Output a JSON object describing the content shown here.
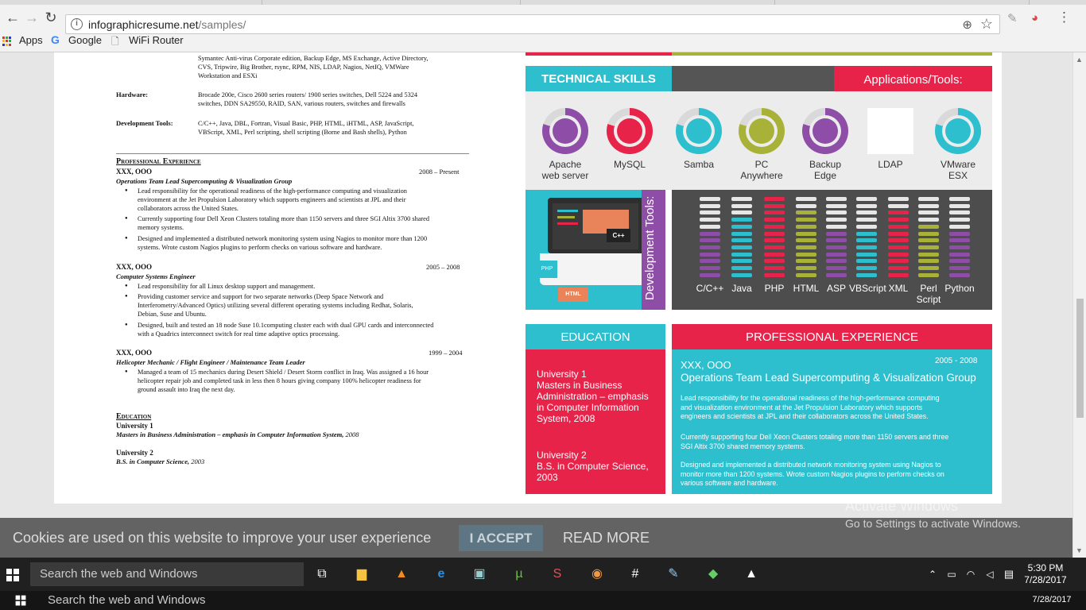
{
  "browser": {
    "url_domain": "infographicresume.net",
    "url_path": "/samples/",
    "bookmarks": [
      "Apps",
      "Google",
      "WiFi Router"
    ]
  },
  "resume": {
    "software_lines": [
      "Symantec Anti-virus Corporate edition, Backup Edge, MS Exchange, Active Directory,",
      "CVS, Tripwire, Big Brother, rsync, RPM, NIS, LDAP, Nagios, NetIQ, VMWare",
      "Workstation and ESXi"
    ],
    "hardware_label": "Hardware:",
    "hardware_lines": [
      "Brocade 200e, Cisco 2600 series routers/ 1900 series switches, Dell 5224 and 5324",
      "switches, DDN SA29550, RAID, SAN, various routers, switches and firewalls"
    ],
    "devtools_label": "Development Tools:",
    "devtools_lines": [
      "C/C++, Java, DBL, Fortran, Visual Basic, PHP, HTML, iHTML, ASP, JavaScript,",
      "VBScript, XML, Perl scripting, shell scripting (Borne and Bash shells), Python"
    ],
    "experience_heading": "Professional Experience",
    "jobs": [
      {
        "company": "XXX, OOO",
        "dates": "2008 – Present",
        "title": "Operations Team Lead Supercomputing & Visualization Group",
        "bullets": [
          [
            "Lead responsibility for the operational readiness of the high-performance computing and visualization",
            "environment at the Jet Propulsion Laboratory which supports engineers and scientists at JPL and their",
            "collaborators across the United States."
          ],
          [
            "Currently supporting four Dell Xeon Clusters totaling more than 1150 servers and three SGI Altix 3700 shared",
            "memory systems."
          ],
          [
            "Designed and implemented a distributed network monitoring system using Nagios to monitor more than 1200",
            "systems.  Wrote custom Nagios plugins to perform checks on various software and hardware."
          ]
        ]
      },
      {
        "company": "XXX, OOO",
        "dates": "2005 – 2008",
        "title": "Computer Systems Engineer",
        "bullets": [
          [
            "Lead responsibility for all Linux desktop support and management."
          ],
          [
            "Providing customer service and support for two separate networks (Deep Space Network and",
            "Interferometry/Advanced Optics) utilizing several different operating systems including Redhat, Solaris,",
            "Debian, Suse and Ubuntu."
          ],
          [
            "Designed, built and tested an 18 node Suse 10.1computing cluster each with dual GPU cards and interconnected",
            "with a Quadrics interconnect switch for real time adaptive optics processing."
          ]
        ]
      },
      {
        "company": "XXX, OOO",
        "dates": "1999 – 2004",
        "title": "Helicopter Mechanic / Flight Engineer / Maintenance Team Leader",
        "bullets": [
          [
            "Managed a team of 15 mechanics during Desert Shield / Desert Storm conflict in Iraq.  Was assigned a 16 hour",
            "helicopter repair job and completed task in less then 8 hours giving company 100% helicopter readiness for",
            "ground assault into Iraq the next day."
          ]
        ]
      }
    ],
    "education_heading": "Education",
    "schools": [
      {
        "name": "University 1",
        "degree": "Masters in Business Administration – emphasis in Computer Information System,",
        "year": "2008"
      },
      {
        "name": "University 2",
        "degree": "B.S. in Computer Science,",
        "year": "2003"
      }
    ]
  },
  "infographic": {
    "technical_skills": "TECHNICAL SKILLS",
    "applications_tools": "Applications/Tools:",
    "apps": [
      {
        "label": "Apache\nweb server",
        "color": "#8e4ea8"
      },
      {
        "label": "MySQL",
        "color": "#e8234a"
      },
      {
        "label": "Samba",
        "color": "#2ebfcf"
      },
      {
        "label": "PC\nAnywhere",
        "color": "#a9b238"
      },
      {
        "label": "Backup\nEdge",
        "color": "#8e4ea8"
      },
      {
        "label": "LDAP",
        "color": "#ffffff"
      },
      {
        "label": "VMware\nESX",
        "color": "#2ebfcf"
      }
    ],
    "dev_tools": "Development Tools:",
    "dev_badges": [
      "C++",
      "PHP",
      "HTML"
    ],
    "languages": [
      "C/C++",
      "Java",
      "PHP",
      "HTML",
      "ASP",
      "VBScript",
      "XML",
      "Perl\nScript",
      "Python"
    ],
    "education_heading": "EDUCATION",
    "education_1": [
      "University 1",
      "Masters in Business",
      "Administration – emphasis",
      "in Computer Information",
      "System, 2008"
    ],
    "education_2": [
      "University 2",
      "B.S. in Computer Science,",
      "2003"
    ],
    "prof_heading": "PROFESSIONAL EXPERIENCE",
    "prof_company": "XXX, OOO",
    "prof_dates": "2005 - 2008",
    "prof_title": "Operations Team Lead Supercomputing & Visualization Group",
    "prof_paras": [
      [
        "Lead responsibility for the operational readiness of the high-performance computing",
        "and visualization environment at the Jet Propulsion Laboratory which supports",
        "engineers and scientists at JPL and their collaborators across the United States."
      ],
      [
        "Currently supporting four Dell Xeon Clusters totaling more than 1150 servers and three",
        "SGI Altix 3700 shared memory systems."
      ],
      [
        "Designed and implemented a distributed network monitoring system using Nagios to",
        "monitor more than 1200 systems.  Wrote custom Nagios plugins to perform checks on",
        "various software and hardware."
      ]
    ]
  },
  "cookie": {
    "message": "Cookies are used on this website to improve your user experience",
    "accept": "I ACCEPT",
    "more": "READ MORE"
  },
  "watermark": {
    "line1": "Activate Windows",
    "line2": "Go to Settings to activate Windows."
  },
  "taskbar": {
    "search": "Search the web and Windows",
    "time": "5:30 PM",
    "date": "7/28/2017"
  }
}
